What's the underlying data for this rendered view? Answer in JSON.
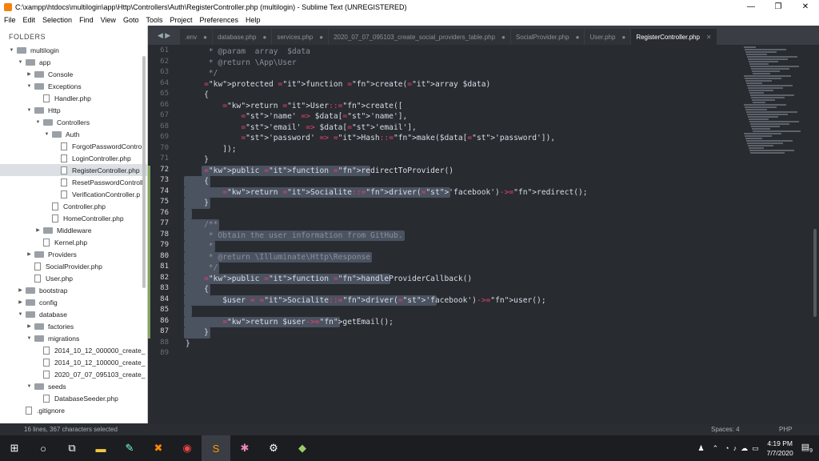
{
  "window": {
    "title": "C:\\xampp\\htdocs\\multilogin\\app\\Http\\Controllers\\Auth\\RegisterController.php (multilogin) - Sublime Text (UNREGISTERED)"
  },
  "menu": [
    "File",
    "Edit",
    "Selection",
    "Find",
    "View",
    "Goto",
    "Tools",
    "Project",
    "Preferences",
    "Help"
  ],
  "sidebar": {
    "header": "FOLDERS",
    "items": [
      {
        "label": "multilogin",
        "depth": 0,
        "type": "folder",
        "open": true
      },
      {
        "label": "app",
        "depth": 1,
        "type": "folder",
        "open": true
      },
      {
        "label": "Console",
        "depth": 2,
        "type": "folder",
        "open": false
      },
      {
        "label": "Exceptions",
        "depth": 2,
        "type": "folder",
        "open": true
      },
      {
        "label": "Handler.php",
        "depth": 3,
        "type": "file"
      },
      {
        "label": "Http",
        "depth": 2,
        "type": "folder",
        "open": true
      },
      {
        "label": "Controllers",
        "depth": 3,
        "type": "folder",
        "open": true
      },
      {
        "label": "Auth",
        "depth": 4,
        "type": "folder",
        "open": true
      },
      {
        "label": "ForgotPasswordContro",
        "depth": 5,
        "type": "file"
      },
      {
        "label": "LoginController.php",
        "depth": 5,
        "type": "file"
      },
      {
        "label": "RegisterController.php",
        "depth": 5,
        "type": "file",
        "selected": true
      },
      {
        "label": "ResetPasswordControll",
        "depth": 5,
        "type": "file"
      },
      {
        "label": "VerificationController.p",
        "depth": 5,
        "type": "file"
      },
      {
        "label": "Controller.php",
        "depth": 4,
        "type": "file"
      },
      {
        "label": "HomeController.php",
        "depth": 4,
        "type": "file"
      },
      {
        "label": "Middleware",
        "depth": 3,
        "type": "folder",
        "open": false
      },
      {
        "label": "Kernel.php",
        "depth": 3,
        "type": "file"
      },
      {
        "label": "Providers",
        "depth": 2,
        "type": "folder",
        "open": false
      },
      {
        "label": "SocialProvider.php",
        "depth": 2,
        "type": "file"
      },
      {
        "label": "User.php",
        "depth": 2,
        "type": "file"
      },
      {
        "label": "bootstrap",
        "depth": 1,
        "type": "folder",
        "open": false
      },
      {
        "label": "config",
        "depth": 1,
        "type": "folder",
        "open": false
      },
      {
        "label": "database",
        "depth": 1,
        "type": "folder",
        "open": true
      },
      {
        "label": "factories",
        "depth": 2,
        "type": "folder",
        "open": false
      },
      {
        "label": "migrations",
        "depth": 2,
        "type": "folder",
        "open": true
      },
      {
        "label": "2014_10_12_000000_create_",
        "depth": 3,
        "type": "file"
      },
      {
        "label": "2014_10_12_100000_create_",
        "depth": 3,
        "type": "file"
      },
      {
        "label": "2020_07_07_095103_create_",
        "depth": 3,
        "type": "file"
      },
      {
        "label": "seeds",
        "depth": 2,
        "type": "folder",
        "open": true
      },
      {
        "label": "DatabaseSeeder.php",
        "depth": 3,
        "type": "file"
      },
      {
        "label": ".gitignore",
        "depth": 1,
        "type": "file"
      }
    ]
  },
  "tabs": [
    {
      "label": ".env",
      "active": false
    },
    {
      "label": "database.php",
      "active": false
    },
    {
      "label": "services.php",
      "active": false
    },
    {
      "label": "2020_07_07_095103_create_social_providers_table.php",
      "active": false
    },
    {
      "label": "SocialProvider.php",
      "active": false
    },
    {
      "label": "User.php",
      "active": false
    },
    {
      "label": "RegisterController.php",
      "active": true
    }
  ],
  "code": {
    "lines": [
      {
        "n": "61",
        "t": "     * @param  array  $data"
      },
      {
        "n": "62",
        "t": "     * @return \\App\\User"
      },
      {
        "n": "63",
        "t": "     */"
      },
      {
        "n": "64",
        "t": "    protected function create(array $data)"
      },
      {
        "n": "65",
        "t": "    {"
      },
      {
        "n": "66",
        "t": "        return User::create(["
      },
      {
        "n": "67",
        "t": "            'name' => $data['name'],"
      },
      {
        "n": "68",
        "t": "            'email' => $data['email'],"
      },
      {
        "n": "69",
        "t": "            'password' => Hash::make($data['password']),"
      },
      {
        "n": "70",
        "t": "        ]);"
      },
      {
        "n": "71",
        "t": "    }"
      },
      {
        "n": "72",
        "t": "    public function redirectToProvider()"
      },
      {
        "n": "73",
        "t": "    {"
      },
      {
        "n": "74",
        "t": "        return Socialite::driver('facebook')->redirect();"
      },
      {
        "n": "75",
        "t": "    }"
      },
      {
        "n": "76",
        "t": ""
      },
      {
        "n": "77",
        "t": "    /**"
      },
      {
        "n": "78",
        "t": "     * Obtain the user information from GitHub."
      },
      {
        "n": "79",
        "t": "     *"
      },
      {
        "n": "80",
        "t": "     * @return \\Illuminate\\Http\\Response"
      },
      {
        "n": "81",
        "t": "     */"
      },
      {
        "n": "82",
        "t": "    public function handleProviderCallback()"
      },
      {
        "n": "83",
        "t": "    {"
      },
      {
        "n": "84",
        "t": "        $user = Socialite::driver('facebook')->user();"
      },
      {
        "n": "85",
        "t": ""
      },
      {
        "n": "86",
        "t": "        return $user->getEmail();"
      },
      {
        "n": "87",
        "t": "    }"
      },
      {
        "n": "88",
        "t": "}"
      },
      {
        "n": "89",
        "t": ""
      }
    ]
  },
  "status": {
    "selection": "16 lines, 367 characters selected",
    "spaces": "Spaces: 4",
    "syntax": "PHP"
  },
  "taskbar": {
    "time": "4:19 PM",
    "date": "7/7/2020",
    "notifications": "9"
  }
}
